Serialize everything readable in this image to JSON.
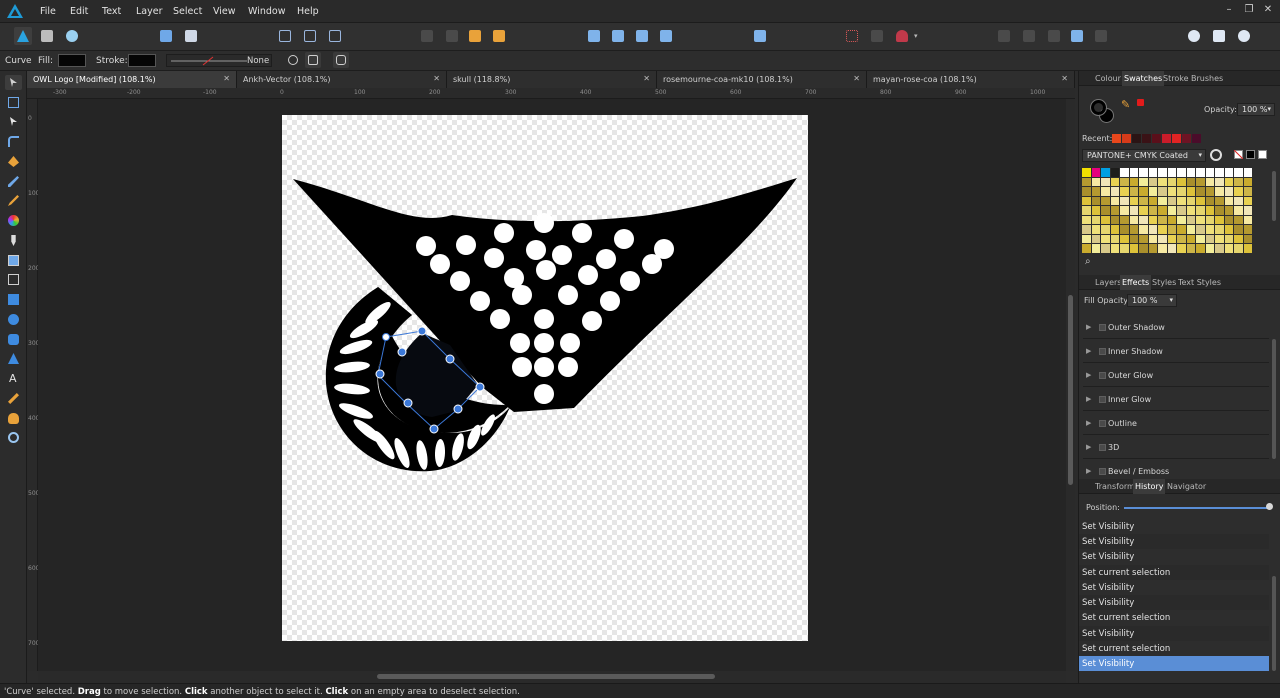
{
  "menu": [
    "File",
    "Edit",
    "Text",
    "Layer",
    "Select",
    "View",
    "Window",
    "Help"
  ],
  "window_controls": {
    "minimize": "–",
    "restore": "❐",
    "close": "✕"
  },
  "context": {
    "tool_name": "Curve",
    "fill_label": "Fill:",
    "stroke_label": "Stroke:",
    "stroke_style": "None"
  },
  "tabs": [
    {
      "label": "OWL Logo [Modified] (108.1%)",
      "active": true
    },
    {
      "label": "Ankh-Vector (108.1%)",
      "active": false
    },
    {
      "label": "skull (118.8%)",
      "active": false
    },
    {
      "label": "rosemourne-coa-mk10 (108.1%)",
      "active": false
    },
    {
      "label": "mayan-rose-coa (108.1%)",
      "active": false
    }
  ],
  "tab_close": "✕",
  "ruler_top": [
    "-300",
    "-200",
    "-100",
    "0",
    "100",
    "200",
    "300",
    "400",
    "500",
    "600",
    "700",
    "800",
    "900",
    "1000"
  ],
  "ruler_left": [
    "0",
    "100",
    "200",
    "300",
    "400",
    "500",
    "600",
    "700"
  ],
  "color_panel": {
    "tabs": [
      "Colour",
      "Swatches",
      "Stroke",
      "Brushes"
    ],
    "active_tab": "Swatches",
    "opacity_label": "Opacity:",
    "opacity_value": "100 %",
    "recent_label": "Recent:",
    "palette_name": "PANTONE+ CMYK Coated",
    "recent_colors": [
      "#e8471c",
      "#d63b1a",
      "#2b1414",
      "#3a1216",
      "#5a0f1a",
      "#c91c2a",
      "#e02424",
      "#6e1424",
      "#4a0c2a"
    ]
  },
  "effects_panel": {
    "tabs": [
      "Layers",
      "Effects",
      "Styles",
      "Text Styles"
    ],
    "active_tab": "Effects",
    "fill_opacity_label": "Fill Opacity:",
    "fill_opacity_value": "100 %",
    "effects": [
      "Outer Shadow",
      "Inner Shadow",
      "Outer Glow",
      "Inner Glow",
      "Outline",
      "3D",
      "Bevel / Emboss"
    ]
  },
  "history_panel": {
    "tabs": [
      "Transform",
      "History",
      "Navigator"
    ],
    "active_tab": "History",
    "position_label": "Position:",
    "entries": [
      "Set Visibility",
      "Set Visibility",
      "Set Visibility",
      "Set current selection",
      "Set Visibility",
      "Set Visibility",
      "Set current selection",
      "Set Visibility",
      "Set current selection",
      "Set Visibility"
    ],
    "selected_index": 9
  },
  "status": {
    "p1": "'Curve' selected. ",
    "b1": "Drag",
    "p2": " to move selection. ",
    "b2": "Click",
    "p3": " another object to select it. ",
    "b3": "Click",
    "p4": " on an empty area to deselect selection."
  },
  "colors": {
    "accent": "#5a8ed6",
    "selection": "#3b78d8",
    "art": "#000000"
  }
}
